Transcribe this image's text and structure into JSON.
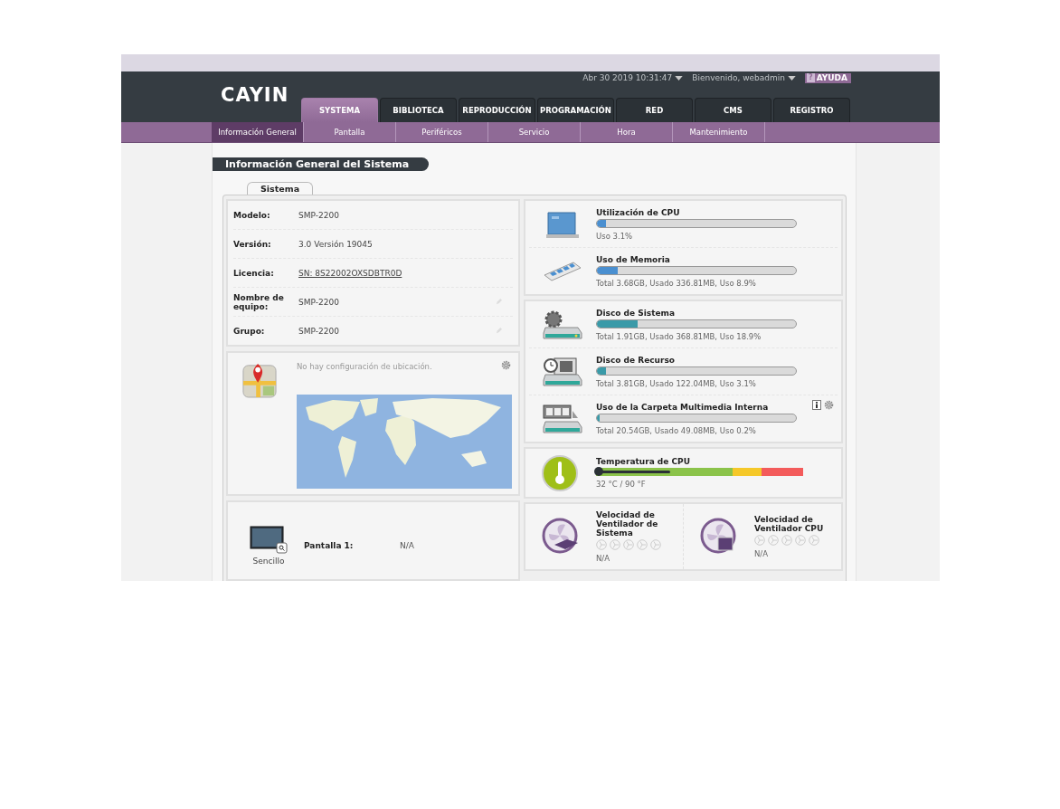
{
  "header": {
    "logo": "CAYIN",
    "datetime": "Abr 30 2019 10:31:47",
    "welcome": "Bienvenido, webadmin",
    "help_icon": "?",
    "help_label": "AYUDA"
  },
  "tabs": [
    {
      "label": "SYSTEMA",
      "selected": true
    },
    {
      "label": "BIBLIOTECA",
      "selected": false
    },
    {
      "label": "REPRODUCCIÓN",
      "selected": false
    },
    {
      "label": "PROGRAMACIÓN",
      "selected": false
    },
    {
      "label": "RED",
      "selected": false
    },
    {
      "label": "CMS",
      "selected": false
    },
    {
      "label": "REGISTRO",
      "selected": false
    }
  ],
  "subtabs": [
    {
      "label": "Información General",
      "selected": true
    },
    {
      "label": "Pantalla",
      "selected": false
    },
    {
      "label": "Periféricos",
      "selected": false
    },
    {
      "label": "Servicio",
      "selected": false
    },
    {
      "label": "Hora",
      "selected": false
    },
    {
      "label": "Mantenimiento",
      "selected": false
    }
  ],
  "page_title": "Información General del Sistema",
  "section_tab": "Sistema",
  "info_rows": [
    {
      "label": "Modelo:",
      "value": "SMP-2200",
      "kind": "text"
    },
    {
      "label": "Versión:",
      "value": "3.0 Versión 19045",
      "kind": "text"
    },
    {
      "label": "Licencia:",
      "value": "SN: 8S22002OXSDBTR0D",
      "kind": "link"
    },
    {
      "label": "Nombre de equipo:",
      "value": "SMP-2200",
      "kind": "editable"
    },
    {
      "label": "Grupo:",
      "value": "SMP-2200",
      "kind": "editable"
    }
  ],
  "location": {
    "message": "No hay configuración de ubicación."
  },
  "displays": [
    {
      "mode": "Sencillo",
      "label": "Pantalla 1:",
      "value": "N/A"
    }
  ],
  "resource_groups": [
    [
      {
        "kind": "cpu",
        "title": "Utilización de CPU",
        "level": 0.031,
        "detail": "Uso 3.1%",
        "actions": false
      },
      {
        "kind": "memory",
        "title": "Uso de Memoria",
        "level": 0.089,
        "detail": "Total 3.68GB, Usado 336.81MB, Uso 8.9%",
        "actions": false
      }
    ],
    [
      {
        "kind": "system-disk",
        "title": "Disco de Sistema",
        "level": 0.189,
        "detail": "Total 1.91GB, Usado 368.81MB, Uso 18.9%",
        "actions": false
      },
      {
        "kind": "resource-disk",
        "title": "Disco de Recurso",
        "level": 0.031,
        "detail": "Total 3.81GB, Usado 122.04MB, Uso 3.1%",
        "actions": false
      },
      {
        "kind": "media-disk",
        "title": "Uso de la Carpeta Multimedia Interna",
        "level": 0.002,
        "detail": "Total 20.54GB, Usado 49.08MB, Uso 0.2%",
        "actions": true
      }
    ]
  ],
  "temperature": {
    "title": "Temperatura de CPU",
    "level": 0.36,
    "reading": "32 °C / 90 °F"
  },
  "fans": [
    {
      "kind": "system",
      "title": "Velocidad de Ventilador de Sistema",
      "reading": "N/A"
    },
    {
      "kind": "cpu",
      "title": "Velocidad de Ventilador CPU",
      "reading": "N/A"
    }
  ]
}
